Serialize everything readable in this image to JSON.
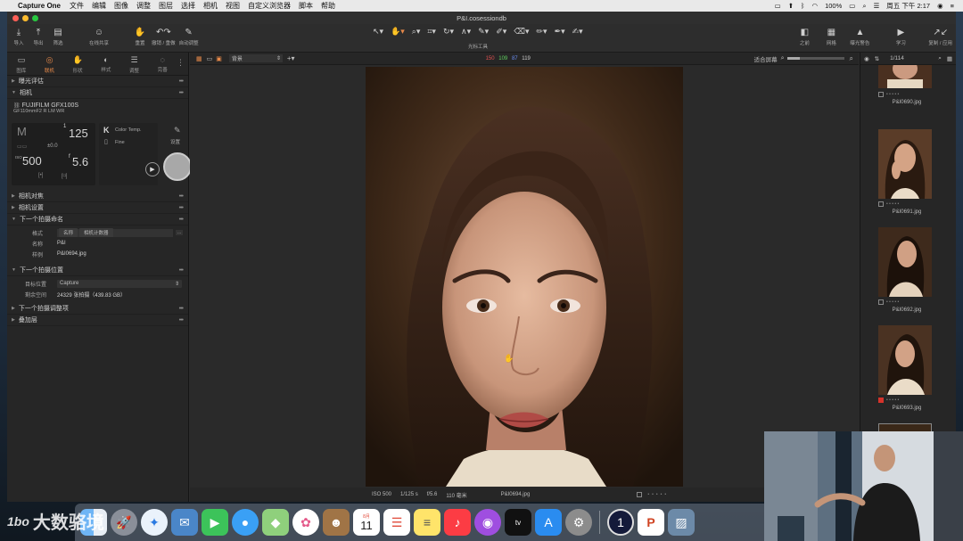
{
  "menubar": {
    "app_name": "Capture One",
    "items": [
      "文件",
      "编辑",
      "图像",
      "调整",
      "图层",
      "选择",
      "相机",
      "视图",
      "自定义浏览器",
      "脚本",
      "帮助"
    ],
    "battery": "100%",
    "clock": "周五 下午 2:17"
  },
  "window": {
    "title": "P&I.cosessiondb"
  },
  "toolbar": {
    "left_buttons": [
      "导入",
      "导出",
      "筛选",
      "在线共享",
      "重置",
      "撤销 / 重做",
      "自动调整"
    ],
    "cursor_tools_label": "光标工具",
    "right_buttons": [
      "之前",
      "网格",
      "曝光警告",
      "学习",
      "复制 / 应用"
    ]
  },
  "left_tabs": [
    {
      "label": "图库",
      "icon": "library-icon"
    },
    {
      "label": "联机",
      "icon": "camera-icon",
      "active": true
    },
    {
      "label": "形状",
      "icon": "shape-icon"
    },
    {
      "label": "样式",
      "icon": "style-icon"
    },
    {
      "label": "调整",
      "icon": "adjust-icon"
    },
    {
      "label": "完善",
      "icon": "refine-icon"
    }
  ],
  "sections": {
    "exposure_eval": "曝光评估",
    "camera": "相机",
    "camera_focus": "相机对焦",
    "camera_settings": "相机设置",
    "next_naming": "下一个拍摄命名",
    "next_location": "下一个拍摄位置",
    "next_adjust": "下一个拍摄调整项",
    "overlay": "叠加层"
  },
  "camera": {
    "model": "FUJIFILM GFX100S",
    "lens": "GF110mmF2 R LM WR",
    "mode": "M",
    "shutter_num": "1",
    "shutter_den": "125",
    "ev": "±0.0",
    "iso_prefix": "ISO",
    "iso": "500",
    "aperture_prefix": "f",
    "aperture": "5.6",
    "wb_letter": "K",
    "wb_label": "Color Temp.",
    "quality": "Fine",
    "settings_label": "设置"
  },
  "naming": {
    "format_label": "格式",
    "format_chips": [
      "名称",
      "相机计数器"
    ],
    "name_label": "名称",
    "name_value": "P&I",
    "sample_label": "样例",
    "sample_value": "P&I0694.jpg"
  },
  "location": {
    "dest_label": "目标位置",
    "dest_value": "Capture",
    "space_label": "剩余空间",
    "space_value": "24329 张拍摄（439.83 GB）"
  },
  "viewer_top": {
    "layer": "背景",
    "fit": "适合屏幕",
    "rgb_r": "150",
    "rgb_g": "109",
    "rgb_b": "87",
    "rgb_l": "119"
  },
  "viewer_bottom": {
    "iso": "ISO 500",
    "shutter": "1/125 s",
    "aperture": "f/5.6",
    "focal": "110 毫米",
    "filename": "P&I0694.jpg"
  },
  "browser": {
    "counter": "1/114",
    "thumbs": [
      {
        "name": "P&I0690.jpg",
        "tag": "none"
      },
      {
        "name": "P&I0691.jpg",
        "tag": "none"
      },
      {
        "name": "P&I0692.jpg",
        "tag": "none"
      },
      {
        "name": "P&I0693.jpg",
        "tag": "red"
      }
    ]
  },
  "dock": {
    "calendar_month": "8月",
    "calendar_day": "11",
    "apps": [
      "finder-icon",
      "launchpad-icon",
      "safari-icon",
      "preview-icon",
      "facetime-icon",
      "messages-icon",
      "maps-icon",
      "photos-icon",
      "contacts-icon",
      "calendar-icon",
      "reminders-icon",
      "notes-icon",
      "music-icon",
      "podcasts-icon",
      "tv-icon",
      "appstore-icon",
      "settings-icon",
      "captureone-icon",
      "powerpoint-icon",
      "photo-icon"
    ]
  },
  "watermark": {
    "logo": "1bo",
    "text": "大数骆境"
  },
  "colors": {
    "accent": "#e88a4a",
    "red_label": "#d6332b",
    "rgb_r": "#e05050",
    "rgb_g": "#5fd05f",
    "rgb_b": "#6a8df0"
  }
}
